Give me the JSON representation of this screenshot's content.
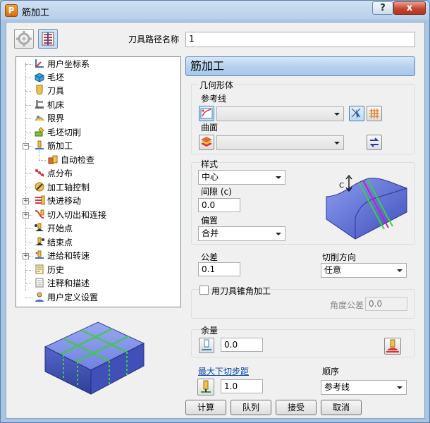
{
  "window": {
    "title": "筋加工",
    "app_icon_letter": "P",
    "help_label": "?",
    "close_label": "x"
  },
  "toolbar": {
    "name_label": "刀具路径名称",
    "name_value": "1"
  },
  "tree": {
    "items": [
      {
        "label": "用户坐标系",
        "icon": "user-coordinate-icon"
      },
      {
        "label": "毛坯",
        "icon": "block-icon"
      },
      {
        "label": "刀具",
        "icon": "tool-icon"
      },
      {
        "label": "机床",
        "icon": "machine-icon"
      },
      {
        "label": "限界",
        "icon": "limits-icon"
      },
      {
        "label": "毛坯切削",
        "icon": "stock-cut-icon"
      },
      {
        "label": "筋加工",
        "icon": "rib-machining-icon"
      },
      {
        "label": "自动检查",
        "icon": "auto-check-icon"
      },
      {
        "label": "点分布",
        "icon": "point-distribution-icon"
      },
      {
        "label": "加工轴控制",
        "icon": "axis-control-icon"
      },
      {
        "label": "快进移动",
        "icon": "rapid-move-icon"
      },
      {
        "label": "切入切出和连接",
        "icon": "leads-links-icon"
      },
      {
        "label": "开始点",
        "icon": "start-point-icon"
      },
      {
        "label": "结束点",
        "icon": "end-point-icon"
      },
      {
        "label": "进给和转速",
        "icon": "feeds-speeds-icon"
      },
      {
        "label": "历史",
        "icon": "history-icon"
      },
      {
        "label": "注释和描述",
        "icon": "notes-icon"
      },
      {
        "label": "用户定义设置",
        "icon": "user-settings-icon"
      }
    ]
  },
  "panel": {
    "header": "筋加工",
    "geometry": {
      "group_label": "几何形体",
      "ref_line_label": "参考线",
      "ref_line_value": "",
      "surface_label": "曲面",
      "surface_value": ""
    },
    "style": {
      "group_label": "样式",
      "style_value": "中心",
      "gap_label": "间隙 (c)",
      "gap_value": "0.0",
      "offset_label": "偏置",
      "offset_value": "合并",
      "preview_c_label": "C"
    },
    "tolerance_label": "公差",
    "tolerance_value": "0.1",
    "cut_dir_label": "切削方向",
    "cut_dir_value": "任意",
    "taper": {
      "checkbox_label": "用刀具锥角加工",
      "checked": false,
      "angle_tol_label": "角度公差",
      "angle_tol_value": "0.0"
    },
    "allowance": {
      "group_label": "余量",
      "value": "0.0"
    },
    "max_stepdown_label": "最大下切步距",
    "max_stepdown_value": "1.0",
    "order_label": "顺序",
    "order_value": "参考线"
  },
  "buttons": {
    "calculate": "计算",
    "queue": "队列",
    "accept": "接受",
    "cancel": "取消"
  },
  "colors": {
    "title_bg": "#b8d0ea",
    "close_red": "#c8452f",
    "header_blue": "#b7d2ef",
    "part_blue": "#5b6fd0",
    "path_green": "#3ad13a"
  }
}
